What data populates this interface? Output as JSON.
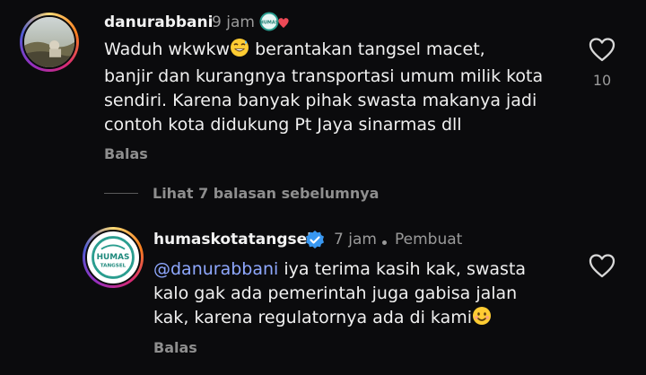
{
  "comment1": {
    "username": "danurabbani",
    "time": "9 jam",
    "text_line1": "Waduh wkwkw",
    "text_line1b": " berantakan tangsel macet,",
    "text_line2": "banjir dan kurangnya transportasi umum milik kota",
    "text_line3": "sendiri. Karena banyak pihak swasta makanya jadi",
    "text_line4": "contoh kota didukung Pt Jaya sinarmas dll",
    "reply_label": "Balas",
    "like_count": "10",
    "badge_text": "HUMAS"
  },
  "view_replies": "Lihat 7 balasan sebelumnya",
  "comment2": {
    "username": "humaskotatangsel",
    "time": "7 jam",
    "creator_label": "Pembuat",
    "mention": "@danurabbani",
    "text_line1": " iya terima kasih kak, swasta",
    "text_line2": "kalo gak ada pemerintah juga gabisa jalan",
    "text_line3": "kak, karena regulatornya ada di kami",
    "reply_label": "Balas",
    "avatar_line1": "HUMAS",
    "avatar_line2": "TANGSEL"
  },
  "colors": {
    "background": "#0b0b0d",
    "mention": "#8fa8ff",
    "verified": "#3897f0",
    "ring_a": "#f9a01b",
    "ring_b": "#d6249f"
  },
  "icons": [
    "heart-outline-icon",
    "verified-badge-icon",
    "grinning-sweat-emoji",
    "smiling-emoji"
  ]
}
